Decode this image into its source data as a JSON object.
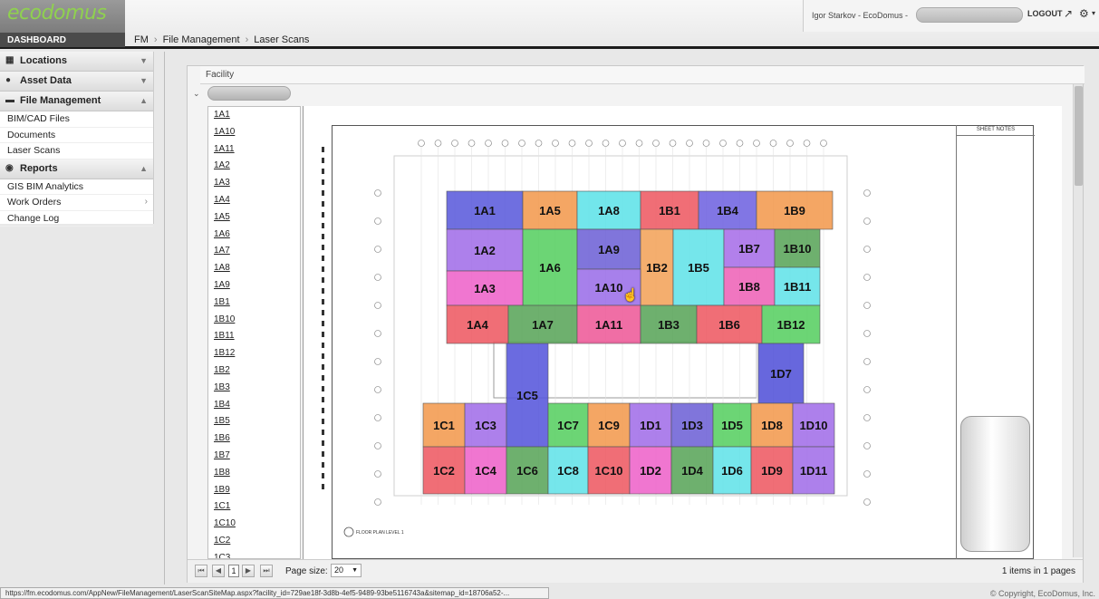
{
  "brand": {
    "logo": "ecodomus",
    "dashboard": "DASHBOARD"
  },
  "breadcrumb": [
    "FM",
    "File Management",
    "Laser Scans"
  ],
  "user": {
    "name": "Igor Starkov - EcoDomus -",
    "logout": "LOGOUT"
  },
  "sidebar": {
    "sections": [
      {
        "label": "Locations",
        "icon": "building-icon"
      },
      {
        "label": "Asset Data",
        "icon": "database-icon"
      },
      {
        "label": "File Management",
        "icon": "folder-icon"
      },
      {
        "label": "Reports",
        "icon": "globe-icon"
      }
    ],
    "file_items": [
      "BIM/CAD Files",
      "Documents",
      "Laser Scans"
    ],
    "report_items": [
      "GIS BIM Analytics",
      "Work Orders",
      "Change Log"
    ]
  },
  "facility_label": "Facility",
  "site_list": [
    "1A1",
    "1A10",
    "1A11",
    "1A2",
    "1A3",
    "1A4",
    "1A5",
    "1A6",
    "1A7",
    "1A8",
    "1A9",
    "1B1",
    "1B10",
    "1B11",
    "1B12",
    "1B2",
    "1B3",
    "1B4",
    "1B5",
    "1B6",
    "1B7",
    "1B8",
    "1B9",
    "1C1",
    "1C10",
    "1C2",
    "1C3"
  ],
  "sheet_notes": "SHEET NOTES",
  "plan_title": "FLOOR PLAN LEVEL 1",
  "zones": [
    {
      "id": "1A1",
      "color": "#5b5bdc"
    },
    {
      "id": "1A5",
      "color": "#f39a4f"
    },
    {
      "id": "1A8",
      "color": "#5fe3e8"
    },
    {
      "id": "1B1",
      "color": "#ee5a63"
    },
    {
      "id": "1B4",
      "color": "#6f63e0"
    },
    {
      "id": "1B9",
      "color": "#f39a4f"
    },
    {
      "id": "1A2",
      "color": "#a26ee8"
    },
    {
      "id": "1A6",
      "color": "#58cf62"
    },
    {
      "id": "1A9",
      "color": "#6e62d6"
    },
    {
      "id": "1B2",
      "color": "#f2a35a"
    },
    {
      "id": "1B5",
      "color": "#62e2e8"
    },
    {
      "id": "1B7",
      "color": "#a76ee8"
    },
    {
      "id": "1B10",
      "color": "#5aa55a"
    },
    {
      "id": "1A3",
      "color": "#ee63c9"
    },
    {
      "id": "1A10",
      "color": "#9b6ee8"
    },
    {
      "id": "1B8",
      "color": "#ee63b7"
    },
    {
      "id": "1B11",
      "color": "#62e2e8"
    },
    {
      "id": "1A4",
      "color": "#ee5a63"
    },
    {
      "id": "1A7",
      "color": "#5aa55a"
    },
    {
      "id": "1A11",
      "color": "#ee5a99"
    },
    {
      "id": "1B3",
      "color": "#5aa55a"
    },
    {
      "id": "1B6",
      "color": "#ee5a63"
    },
    {
      "id": "1B12",
      "color": "#58cf62"
    },
    {
      "id": "1D7",
      "color": "#5252d8"
    },
    {
      "id": "1C1",
      "color": "#f39a4f"
    },
    {
      "id": "1C3",
      "color": "#a26ee8"
    },
    {
      "id": "1C5",
      "color": "#5656dc"
    },
    {
      "id": "1C7",
      "color": "#58cf62"
    },
    {
      "id": "1C9",
      "color": "#f39a4f"
    },
    {
      "id": "1D1",
      "color": "#a26ee8"
    },
    {
      "id": "1D3",
      "color": "#6e62d6"
    },
    {
      "id": "1D5",
      "color": "#58cf62"
    },
    {
      "id": "1D8",
      "color": "#f39a4f"
    },
    {
      "id": "1D10",
      "color": "#a26ee8"
    },
    {
      "id": "1C2",
      "color": "#ee5a63"
    },
    {
      "id": "1C4",
      "color": "#ee63c9"
    },
    {
      "id": "1C6",
      "color": "#5aa55a"
    },
    {
      "id": "1C8",
      "color": "#62e2e8"
    },
    {
      "id": "1C10",
      "color": "#ee5a63"
    },
    {
      "id": "1D2",
      "color": "#ee63c9"
    },
    {
      "id": "1D4",
      "color": "#5aa55a"
    },
    {
      "id": "1D6",
      "color": "#62e2e8"
    },
    {
      "id": "1D9",
      "color": "#ee5a63"
    },
    {
      "id": "1D11",
      "color": "#a26ee8"
    }
  ],
  "pager": {
    "page": "1",
    "size_label": "Page size:",
    "size": "20",
    "info": "1 items in 1 pages"
  },
  "status_url": "https://fm.ecodomus.com/AppNew/FileManagement/LaserScanSiteMap.aspx?facility_id=729ae18f-3d8b-4ef5-9489-93be5116743a&sitemap_id=18706a52-...",
  "copyright": "© Copyright, EcoDomus, Inc."
}
